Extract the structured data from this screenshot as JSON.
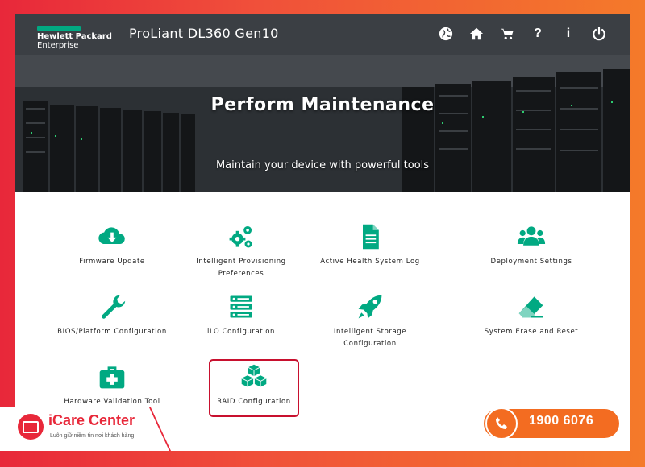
{
  "header": {
    "brand_line1": "Hewlett Packard",
    "brand_line2": "Enterprise",
    "product": "ProLiant DL360 Gen10",
    "help_label": "?",
    "info_label": "i"
  },
  "hero": {
    "title": "Perform Maintenance",
    "subtitle": "Maintain your device with powerful tools"
  },
  "tiles": [
    {
      "label": "Firmware Update",
      "icon": "cloud-download-icon"
    },
    {
      "label": "Intelligent Provisioning Preferences",
      "line1": "Intelligent Provisioning",
      "line2": "Preferences",
      "icon": "gears-icon"
    },
    {
      "label": "Active Health System Log",
      "icon": "document-icon"
    },
    {
      "label": "Deployment Settings",
      "icon": "users-icon"
    },
    {
      "label": "BIOS/Platform Configuration",
      "icon": "wrench-icon"
    },
    {
      "label": "iLO Configuration",
      "icon": "server-icon"
    },
    {
      "label": "Intelligent Storage Configuration",
      "line1": "Intelligent Storage",
      "line2": "Configuration",
      "icon": "rocket-icon"
    },
    {
      "label": "System Erase and Reset",
      "icon": "eraser-icon"
    },
    {
      "label": "Hardware Validation Tool",
      "icon": "medkit-icon"
    },
    {
      "label": "RAID Configuration",
      "icon": "cubes-icon"
    }
  ],
  "overlay": {
    "brand": "iCare Center",
    "tagline": "Luôn giữ niềm tin nơi khách hàng",
    "phone": "1900 6076"
  },
  "colors": {
    "accent": "#01a982",
    "highlight": "#c8102e",
    "topbar": "#3b3f44",
    "phone": "#f36c21"
  }
}
